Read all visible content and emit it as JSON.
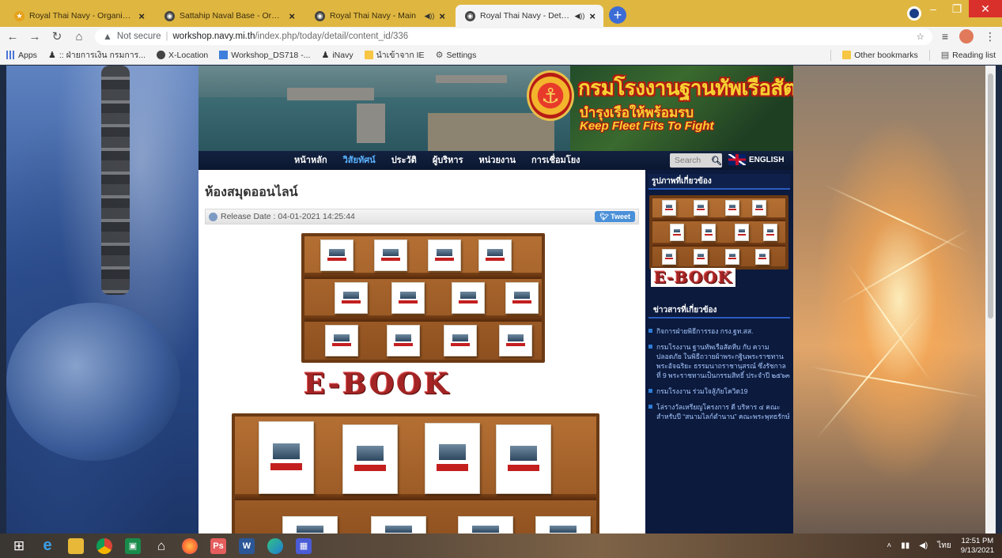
{
  "browser": {
    "tabs": [
      {
        "title": "Royal Thai Navy - Organization",
        "icon": "star-favicon",
        "active": false
      },
      {
        "title": "Sattahip Naval Base - Organizati",
        "icon": "globe-favicon",
        "active": false
      },
      {
        "title": "Royal Thai Navy - Main",
        "icon": "globe-favicon",
        "active": false
      },
      {
        "title": "Royal Thai Navy - Detail Too",
        "icon": "globe-favicon",
        "active": true
      }
    ],
    "new_tab": "+",
    "window_controls": {
      "minimize": "–",
      "maximize": "❐",
      "close": "✕"
    },
    "address": {
      "security": "Not secure",
      "host": "workshop.navy.mi.th",
      "path": "/index.php/today/detail/content_id/336"
    },
    "bookmarks": [
      {
        "label": "Apps",
        "icon": "apps-grid-icon"
      },
      {
        "label": ":: ฝ่ายการเงิน กรมการ...",
        "icon": "figure-icon"
      },
      {
        "label": "X-Location",
        "icon": "globe-icon"
      },
      {
        "label": "Workshop_DS718 -...",
        "icon": "workshop-icon"
      },
      {
        "label": "iNavy",
        "icon": "figure-icon"
      },
      {
        "label": "นำเข้าจาก IE",
        "icon": "folder-icon"
      },
      {
        "label": "Settings",
        "icon": "gear-icon"
      }
    ],
    "bookmarks_right": [
      {
        "label": "Other bookmarks",
        "icon": "folder-icon"
      },
      {
        "label": "Reading list",
        "icon": "reading-list-icon"
      }
    ]
  },
  "site": {
    "banner": {
      "title": "กรมโรงงานฐานทัพเรือสัตหีบ",
      "subtitle": "บำรุงเรือให้พร้อมรบ",
      "motto": "Keep Fleet Fits To Fight"
    },
    "nav": [
      "หน้าหลัก",
      "วิสัยทัศน์",
      "ประวัติ",
      "ผู้บริหาร",
      "หน่วยงาน",
      "การเชื่อมโยง"
    ],
    "nav_active_index": 1,
    "search_placeholder": "Search",
    "language": "ENGLISH",
    "article": {
      "title": "ห้องสมุดออนไลน์",
      "release": "Release Date : 04-01-2021 14:25:44",
      "tweet": "Tweet",
      "ebook_label": "E-BOOK"
    },
    "sidebar": {
      "gallery_heading": "รูปภาพที่เกี่ยวข้อง",
      "gallery_ebook": "E-BOOK",
      "news_heading": "ข่าวสารที่เกี่ยวข้อง",
      "news": [
        "กิจการฝ่ายพิธีการรอง กรง.ฐท.สส.",
        "กรมโรงงาน ฐานทัพเรือสัตหีบ กับ ความปลอดภัย ในพิธีถวายผ้าพระกฐินพระราชทาน พระอัจฉริยะ ธรรมนาถราชานุสรณ์ ซึ่งรัชกาลที่ 9 พระราชทานเป็นกรรมสิทธิ์ ประจำปี ๒๕๖๓",
        "กรมโรงงาน ร่วมใจสู้ภัยโควิด19",
        "โล่รางวัลเหรียญโครงการ ดี บริหาร ๔ คณะ สำหรับปี “สนามไลก์ตำนาน” คณะพระพุทธรักษ์"
      ]
    }
  },
  "taskbar": {
    "apps": [
      "windows-start-icon",
      "edge-icon",
      "file-explorer-icon",
      "chrome-icon",
      "terminal-icon",
      "home-icon",
      "firefox-icon",
      "photoshop-icon",
      "word-icon",
      "edge-new-icon",
      "calculator-icon"
    ],
    "tray_lang": "ไทย",
    "time": "12:51 PM",
    "date": "9/13/2021"
  }
}
